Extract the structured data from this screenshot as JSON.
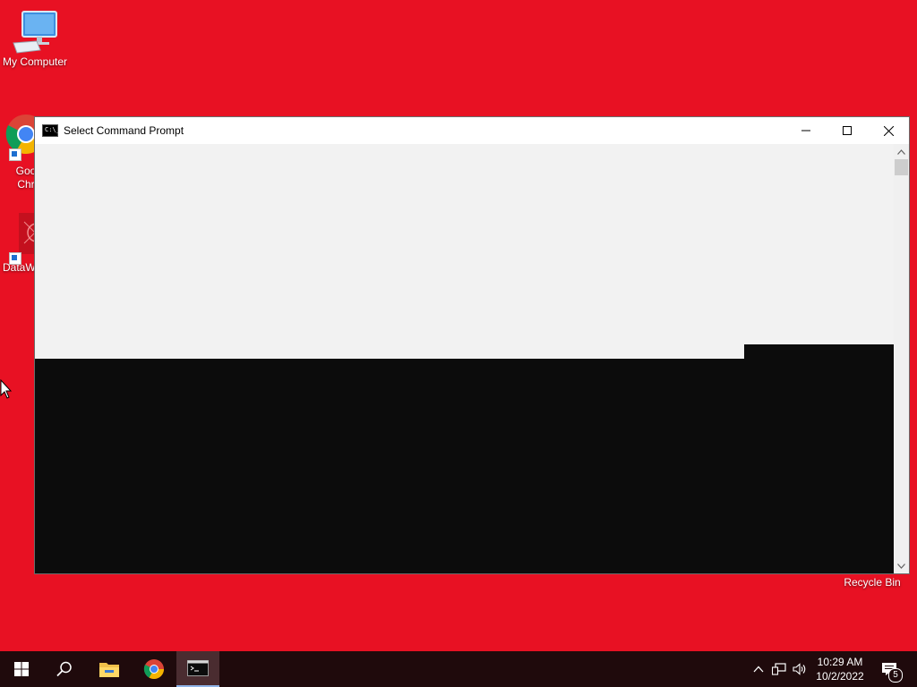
{
  "desktop": {
    "background_color": "#e81123",
    "icons": [
      {
        "label": "My Computer",
        "icon": "computer-icon"
      },
      {
        "label": "Goo\nChr",
        "icon": "chrome-icon"
      },
      {
        "label": "DataW",
        "icon": "datawrapper-icon"
      },
      {
        "label": "Recycle Bin",
        "icon": "recycle-bin-icon"
      }
    ]
  },
  "window": {
    "title": "Select Command Prompt",
    "icon": "cmd-icon",
    "icon_text": "C:\\_",
    "controls": [
      "minimize-icon",
      "maximize-icon",
      "close-icon"
    ]
  },
  "taskbar": {
    "items": [
      "windows-start-icon",
      "search-icon",
      "file-explorer-icon",
      "chrome-icon",
      "cmd-icon"
    ],
    "tray": [
      "chevron-up-icon",
      "network-icon",
      "volume-icon"
    ],
    "clock": {
      "time": "10:29 AM",
      "date": "10/2/2022"
    },
    "notification_count": "5"
  }
}
